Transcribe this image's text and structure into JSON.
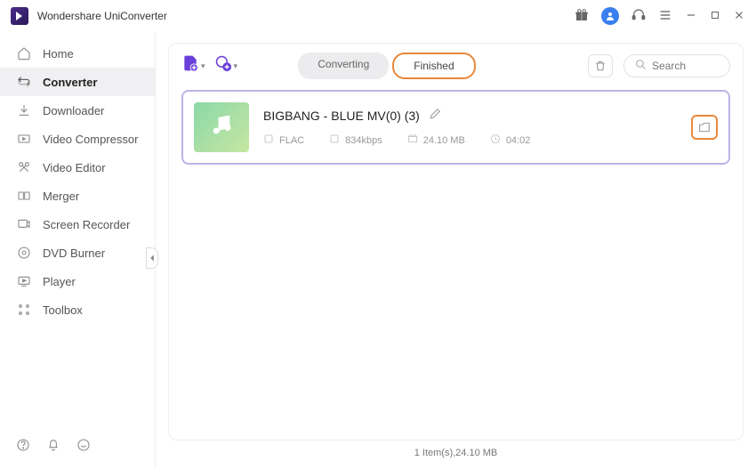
{
  "app": {
    "title": "Wondershare UniConverter"
  },
  "sidebar": {
    "items": [
      {
        "label": "Home"
      },
      {
        "label": "Converter"
      },
      {
        "label": "Downloader"
      },
      {
        "label": "Video Compressor"
      },
      {
        "label": "Video Editor"
      },
      {
        "label": "Merger"
      },
      {
        "label": "Screen Recorder"
      },
      {
        "label": "DVD Burner"
      },
      {
        "label": "Player"
      },
      {
        "label": "Toolbox"
      }
    ]
  },
  "tabs": {
    "converting": "Converting",
    "finished": "Finished"
  },
  "search": {
    "placeholder": "Search"
  },
  "item": {
    "title": "BIGBANG - BLUE MV(0) (3)",
    "format": "FLAC",
    "bitrate": "834kbps",
    "size": "24.10 MB",
    "duration": "04:02"
  },
  "status": "1 Item(s),24.10 MB"
}
